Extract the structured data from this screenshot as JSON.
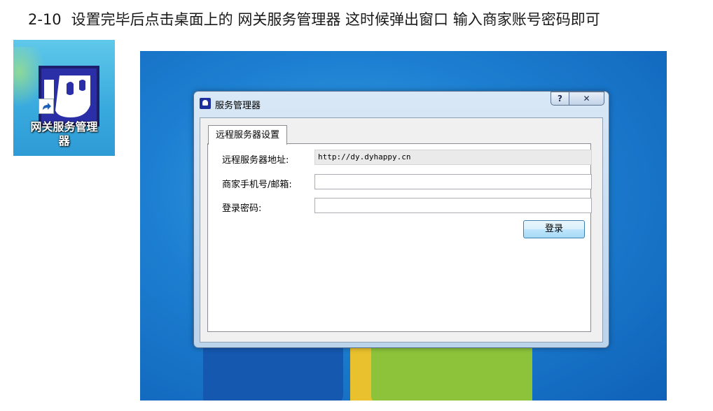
{
  "caption": {
    "step": "2-10",
    "text": "设置完毕后点击桌面上的 网关服务管理器 这时候弹出窗口 输入商家账号密码即可"
  },
  "shortcut": {
    "label_line1": "网关服务管理",
    "label_line2": "器",
    "icon": "gateway-app-icon"
  },
  "window": {
    "title": "服务管理器",
    "help_label": "?",
    "close_label": "✕",
    "tab_label": "远程服务器设置",
    "fields": {
      "server_label": "远程服务器地址:",
      "server_value": "http://dy.dyhappy.cn",
      "account_label": "商家手机号/邮箱:",
      "account_value": "",
      "password_label": "登录密码:",
      "password_value": ""
    },
    "login_label": "登录"
  }
}
